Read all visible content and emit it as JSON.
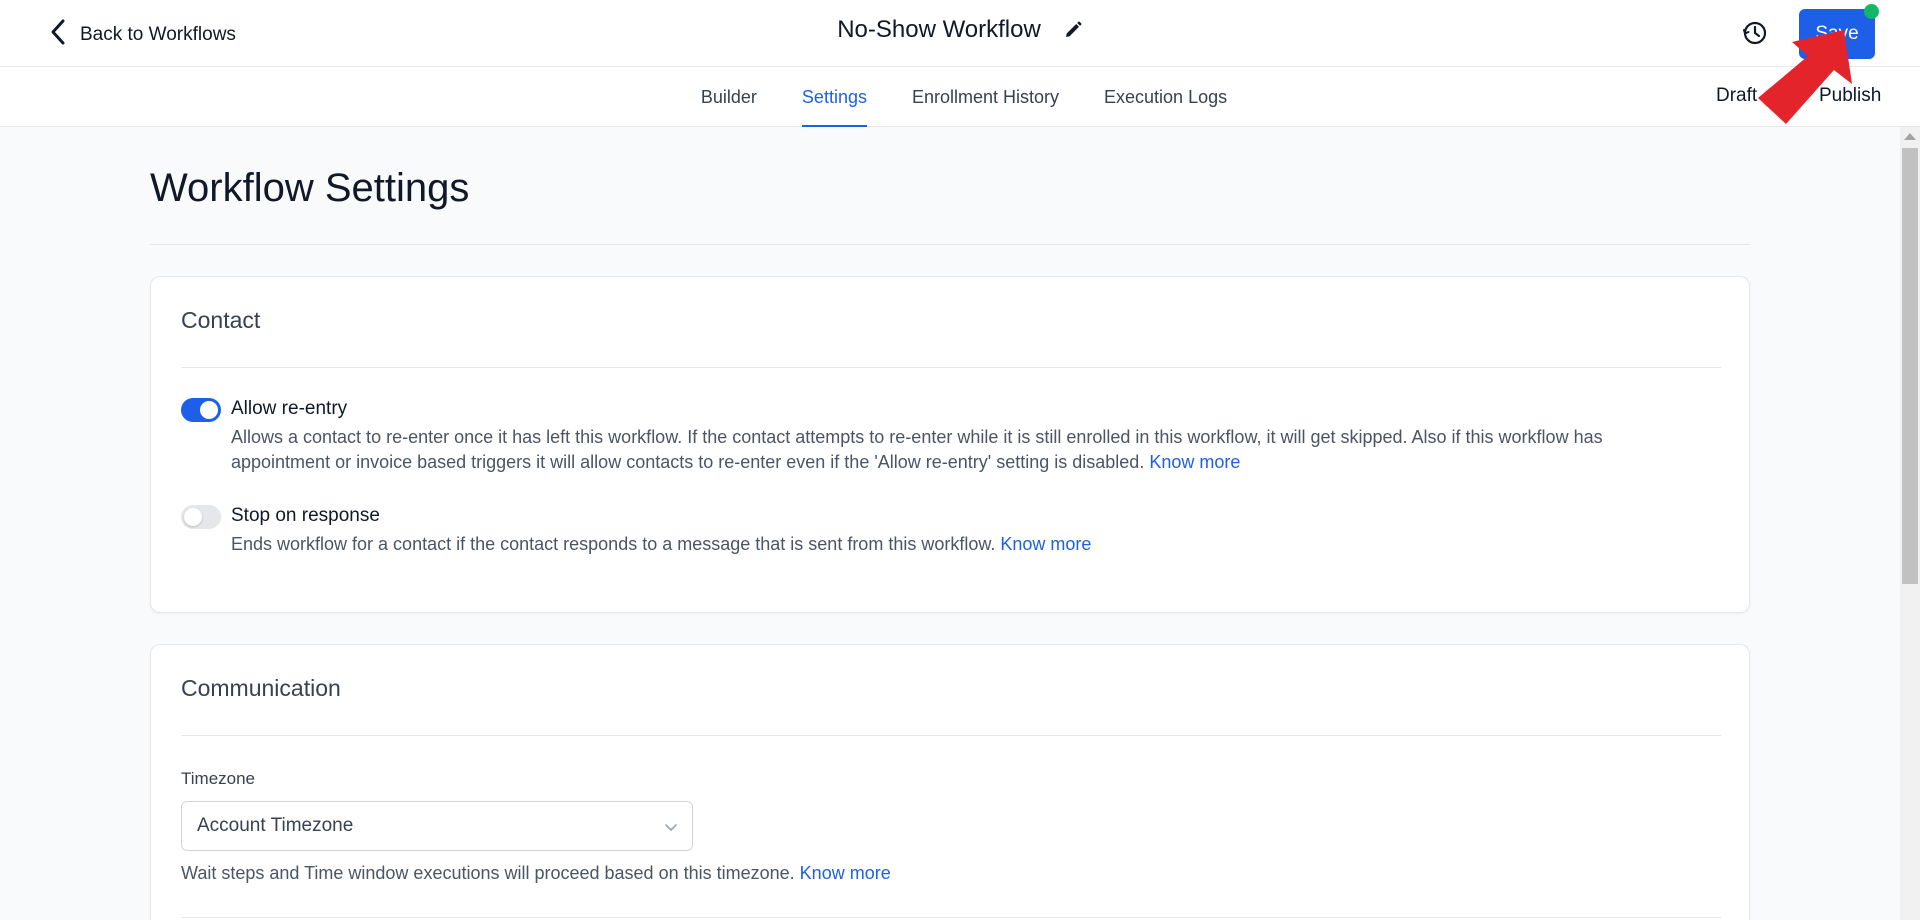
{
  "topbar": {
    "back_label": "Back to Workflows",
    "workflow_title": "No-Show Workflow",
    "save_label": "Save"
  },
  "tabs": [
    {
      "label": "Builder",
      "active": false
    },
    {
      "label": "Settings",
      "active": true
    },
    {
      "label": "Enrollment History",
      "active": false
    },
    {
      "label": "Execution Logs",
      "active": false
    }
  ],
  "publish_state": {
    "draft_label": "Draft",
    "publish_label": "Publish",
    "published": false
  },
  "page": {
    "title": "Workflow Settings"
  },
  "contact": {
    "title": "Contact",
    "options": [
      {
        "label": "Allow re-entry",
        "enabled": true,
        "description_line1": "Allows a contact to re-enter once it has left this workflow. If the contact attempts to re-enter while it is still enrolled in this workflow, it will get skipped. Also if this workflow has",
        "description_line2": "appointment or invoice based triggers it will allow contacts to re-enter even if the 'Allow re-entry' setting is disabled.",
        "link": "Know more"
      },
      {
        "label": "Stop on response",
        "enabled": false,
        "description": "Ends workflow for a contact if the contact responds to a message that is sent from this workflow.",
        "link": "Know more"
      }
    ]
  },
  "communication": {
    "title": "Communication",
    "timezone_label": "Timezone",
    "timezone_value": "Account Timezone",
    "timezone_help": "Wait steps and Time window executions will proceed based on this timezone.",
    "timezone_link": "Know more"
  },
  "colors": {
    "accent": "#1d5fe8",
    "status_dot": "#12b76a",
    "annotation_arrow": "#e3252b"
  }
}
